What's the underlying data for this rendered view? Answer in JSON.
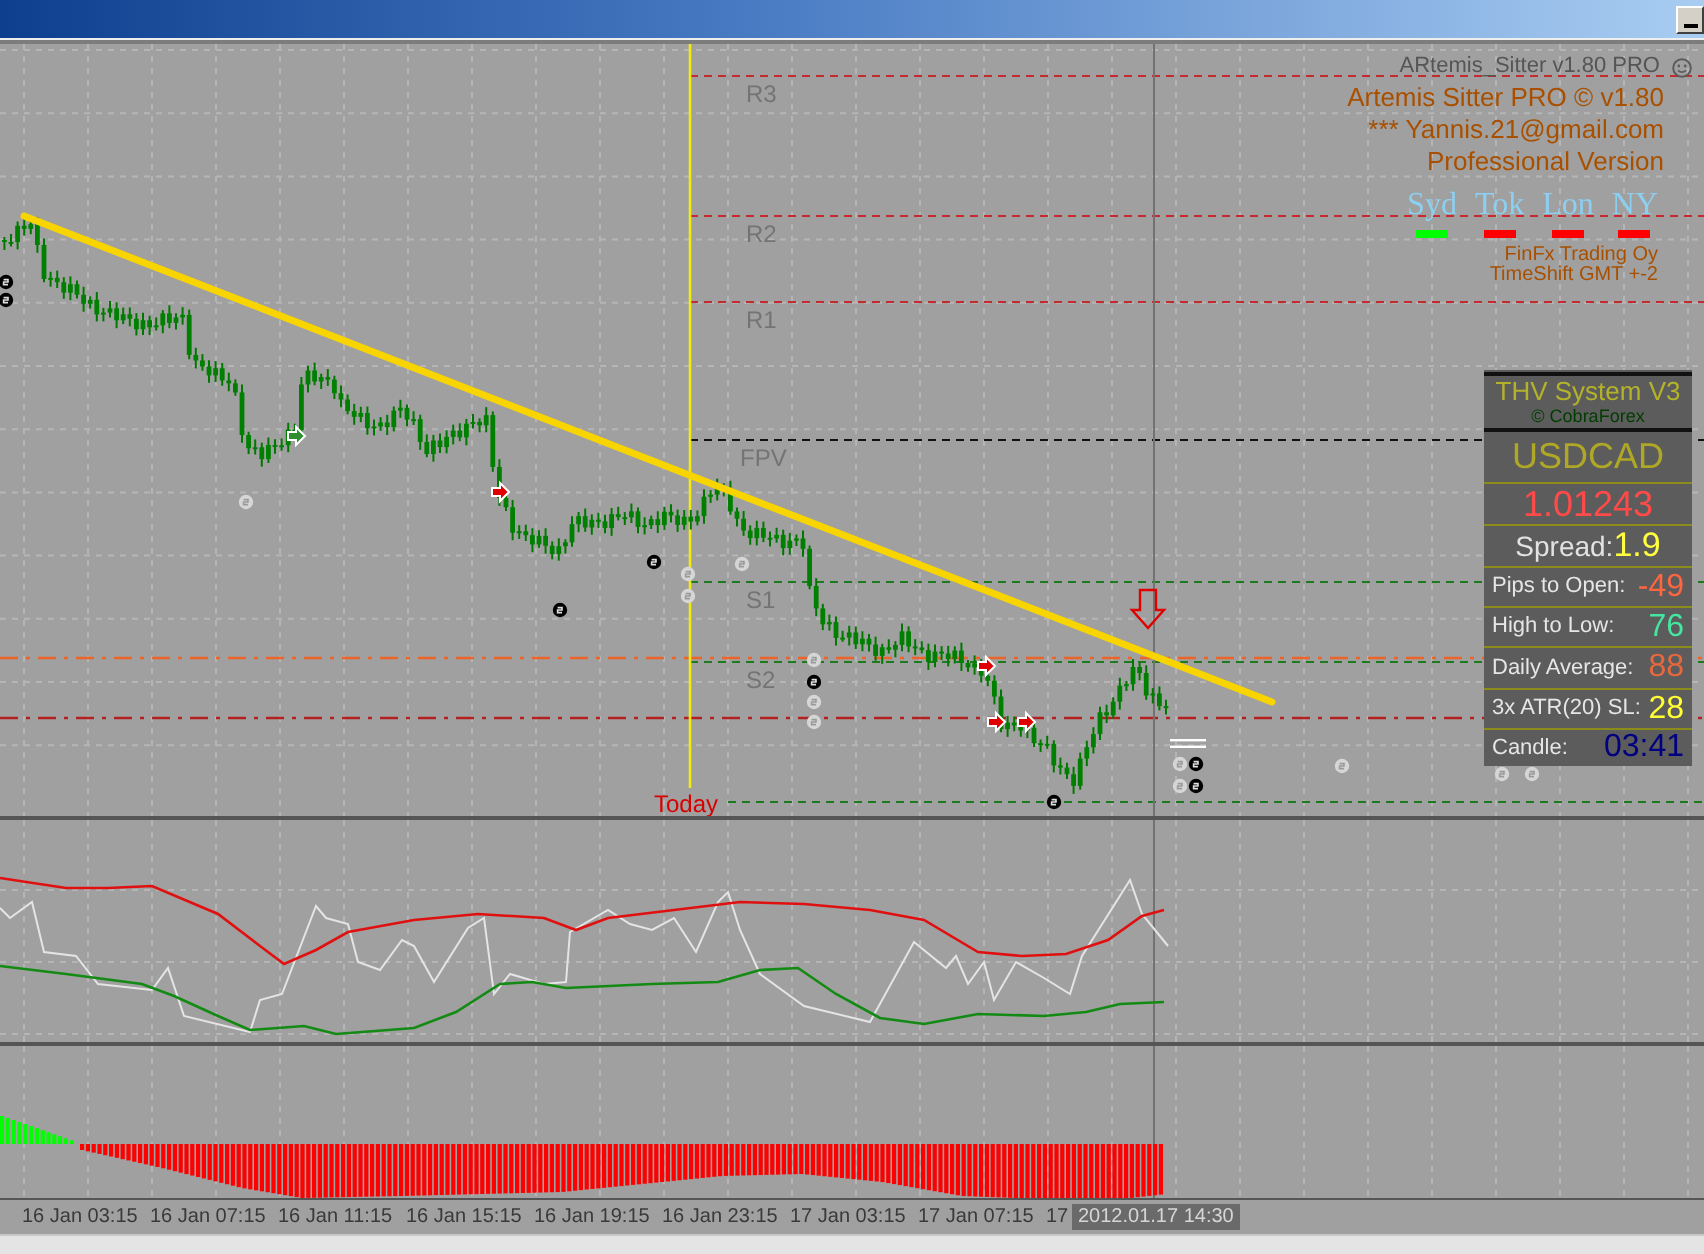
{
  "chart": {
    "indicator_label": "ARtemis_Sitter v1.80 PRO",
    "info_lines": [
      "Artemis Sitter PRO © v1.80",
      "*** Yannis.21@gmail.com",
      "Professional Version"
    ],
    "sessions": [
      {
        "label": "Syd",
        "color": "#00ff00"
      },
      {
        "label": "Tok",
        "color": "#ff0000"
      },
      {
        "label": "Lon",
        "color": "#ff0000"
      },
      {
        "label": "NY",
        "color": "#ff0000"
      }
    ],
    "broker_lines": [
      "FinFx Trading Oy",
      "TimeShift GMT +-2"
    ],
    "pivot_levels": [
      {
        "label": "R3",
        "kind": "resistance"
      },
      {
        "label": "R2",
        "kind": "resistance"
      },
      {
        "label": "R1",
        "kind": "resistance"
      },
      {
        "label": "FPV",
        "kind": "pivot"
      },
      {
        "label": "S1",
        "kind": "support"
      },
      {
        "label": "S2",
        "kind": "support"
      }
    ],
    "today_label": "Today"
  },
  "info_panel": {
    "title": "THV System V3",
    "credit": "© CobraForex",
    "symbol": "USDCAD",
    "price": "1.01243",
    "spread_label": "Spread:",
    "spread": "1.9",
    "rows": [
      {
        "label": "Pips to Open:",
        "value": "-49",
        "color": "#ff6640"
      },
      {
        "label": "High to Low:",
        "value": "76",
        "color": "#44e6a0"
      },
      {
        "label": "Daily Average:",
        "value": "88",
        "color": "#e8683e"
      },
      {
        "label": "3x ATR(20) SL:",
        "value": "28",
        "color": "#ffff33"
      },
      {
        "label": "Candle:",
        "value": "03:41",
        "color": "#000080"
      }
    ]
  },
  "time_axis": {
    "labels": [
      "16 Jan 03:15",
      "16 Jan 07:15",
      "16 Jan 11:15",
      "16 Jan 15:15",
      "16 Jan 19:15",
      "16 Jan 23:15",
      "17 Jan 03:15",
      "17 Jan 07:15",
      "17"
    ],
    "cursor_time": "2012.01.17 14:30"
  }
}
